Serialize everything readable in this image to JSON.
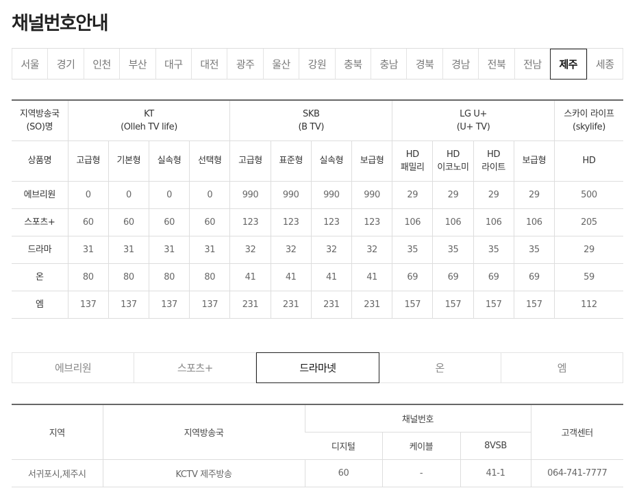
{
  "page": {
    "title": "채널번호안내"
  },
  "regions": {
    "items": [
      "서울",
      "경기",
      "인천",
      "부산",
      "대구",
      "대전",
      "광주",
      "울산",
      "강원",
      "충북",
      "충남",
      "경북",
      "경남",
      "전북",
      "전남",
      "제주",
      "세종"
    ],
    "active": "제주"
  },
  "channel_table": {
    "headers": {
      "so_label_1": "지역방송국",
      "so_label_2": "(SO)명",
      "kt_1": "KT",
      "kt_2": "(Olleh TV life)",
      "skb_1": "SKB",
      "skb_2": "(B TV)",
      "lgu_1": "LG U+",
      "lgu_2": "(U+ TV)",
      "sky_1": "스카이 라이프",
      "sky_2": "(skylife)",
      "product_label": "상품명",
      "kt_products": [
        "고급형",
        "기본형",
        "실속형",
        "선택형"
      ],
      "skb_products": [
        "고급형",
        "표준형",
        "실속형",
        "보급형"
      ],
      "lgu_products": [
        {
          "l1": "HD",
          "l2": "패밀리"
        },
        {
          "l1": "HD",
          "l2": "이코노미"
        },
        {
          "l1": "HD",
          "l2": "라이트"
        },
        {
          "l1": "보급형",
          "l2": ""
        }
      ],
      "sky_products": [
        "HD"
      ]
    },
    "rows": [
      {
        "name": "에브리원",
        "values": [
          "0",
          "0",
          "0",
          "0",
          "990",
          "990",
          "990",
          "990",
          "29",
          "29",
          "29",
          "29",
          "500"
        ]
      },
      {
        "name": "스포츠+",
        "values": [
          "60",
          "60",
          "60",
          "60",
          "123",
          "123",
          "123",
          "123",
          "106",
          "106",
          "106",
          "106",
          "205"
        ]
      },
      {
        "name": "드라마",
        "values": [
          "31",
          "31",
          "31",
          "31",
          "32",
          "32",
          "32",
          "32",
          "35",
          "35",
          "35",
          "35",
          "29"
        ]
      },
      {
        "name": "온",
        "values": [
          "80",
          "80",
          "80",
          "80",
          "41",
          "41",
          "41",
          "41",
          "69",
          "69",
          "69",
          "69",
          "59"
        ]
      },
      {
        "name": "엠",
        "values": [
          "137",
          "137",
          "137",
          "137",
          "231",
          "231",
          "231",
          "231",
          "157",
          "157",
          "157",
          "157",
          "112"
        ]
      }
    ]
  },
  "channel_tabs": {
    "items": [
      "에브리원",
      "스포츠+",
      "드라마넷",
      "온",
      "엠"
    ],
    "active": "드라마넷"
  },
  "info_table": {
    "headers": {
      "region": "지역",
      "station": "지역방송국",
      "channel_number": "채널번호",
      "digital": "디지털",
      "cable": "케이블",
      "vsb": "8VSB",
      "customer_center": "고객센터"
    },
    "rows": [
      {
        "region": "서귀포시,제주시",
        "station": "KCTV 제주방송",
        "digital": "60",
        "cable": "-",
        "vsb": "41-1",
        "phone": "064-741-7777"
      }
    ]
  }
}
